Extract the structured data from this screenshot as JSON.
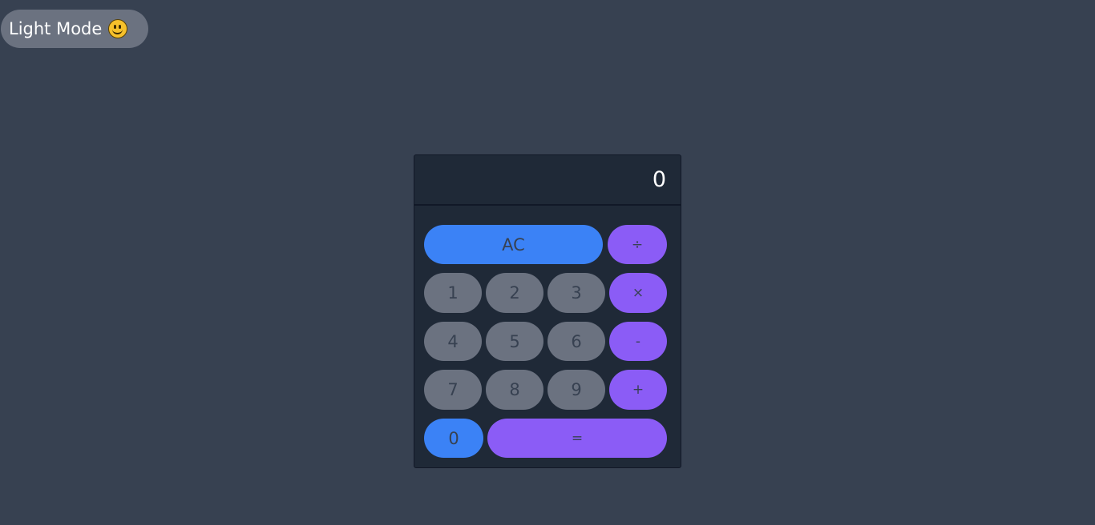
{
  "theme_toggle": {
    "label": "Light Mode",
    "icon": "smiley-face-icon"
  },
  "display": {
    "value": "0"
  },
  "buttons": {
    "clear": "AC",
    "divide": "÷",
    "multiply": "×",
    "subtract": "-",
    "add": "+",
    "equals": "=",
    "one": "1",
    "two": "2",
    "three": "3",
    "four": "4",
    "five": "5",
    "six": "6",
    "seven": "7",
    "eight": "8",
    "nine": "9",
    "zero": "0"
  },
  "colors": {
    "background": "#374151",
    "calculator": "#1f2937",
    "number_key": "#6b7280",
    "operator_key": "#8b5cf6",
    "accent_key": "#3b82f6"
  }
}
